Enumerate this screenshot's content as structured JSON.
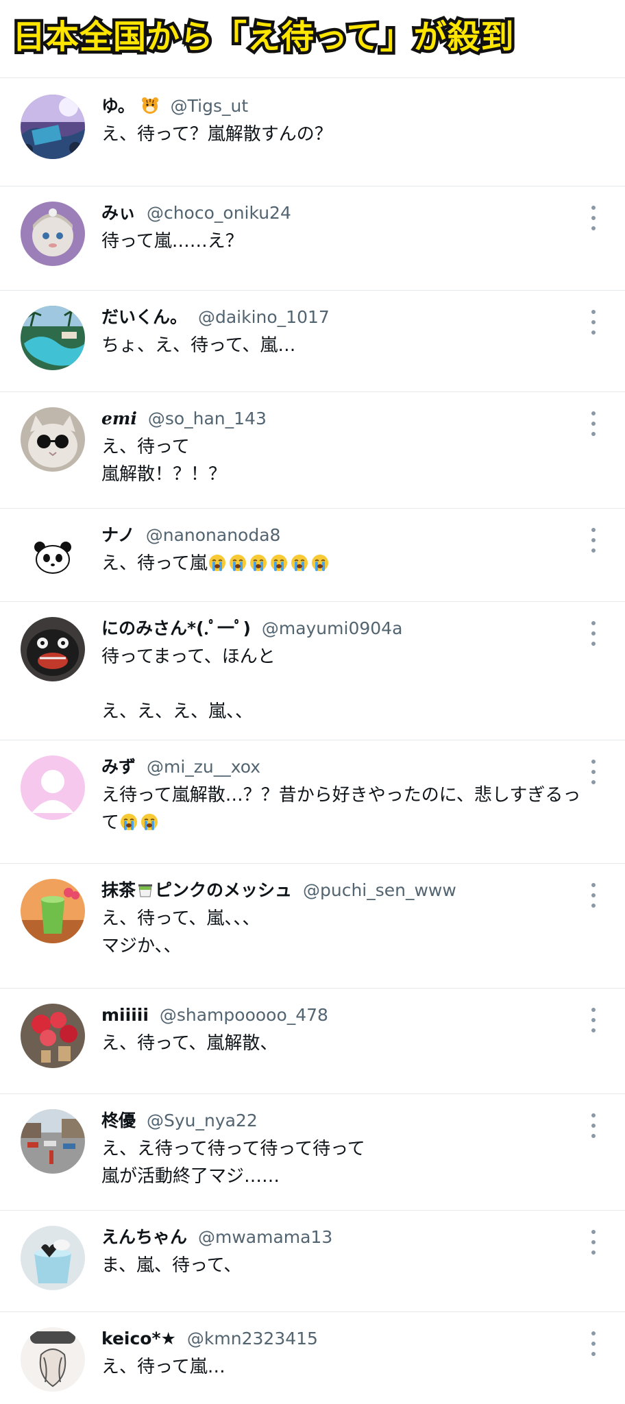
{
  "headline": "日本全国から「え待って」が殺到",
  "colors": {
    "headline_fill": "#ffe600",
    "headline_outline": "#111111",
    "handle": "#536471",
    "divider": "#e6e9ec"
  },
  "tweets": [
    {
      "name": "ゆ。",
      "name_emoji": "tiger-face-emoji",
      "handle": "@Tigs_ut",
      "text": "え、待って？嵐解散すんの？",
      "text_emoji_count": 0,
      "avatar_icon": "concert-crowd-avatar",
      "has_menu": false
    },
    {
      "name": "みぃ",
      "handle": "@choco_oniku24",
      "text": "待って嵐……え？",
      "text_emoji_count": 0,
      "avatar_icon": "plush-doll-avatar",
      "has_menu": true
    },
    {
      "name": "だいくん。",
      "handle": "@daikino_1017",
      "text": "ちょ、え、待って、嵐…",
      "text_emoji_count": 0,
      "avatar_icon": "resort-pool-avatar",
      "has_menu": true
    },
    {
      "name": "emi",
      "handle": "@so_han_143",
      "text": "え、待って\n嵐解散！？！？",
      "text_emoji_count": 0,
      "avatar_icon": "cat-sunglasses-avatar",
      "has_menu": true
    },
    {
      "name": "ナノ",
      "handle": "@nanonanoda8",
      "text": "え、待って嵐",
      "text_emoji_count": 6,
      "text_emoji": "loudly-crying-face-emoji",
      "avatar_icon": "panda-avatar",
      "has_menu": true
    },
    {
      "name": "にのみさん*(.ﾟ一ﾟ)",
      "handle": "@mayumi0904a",
      "text": "待ってまって、ほんと\n\nえ、え、え、嵐、、",
      "text_emoji_count": 0,
      "avatar_icon": "black-creature-avatar",
      "has_menu": true
    },
    {
      "name": "みず",
      "handle": "@mi_zu__xox",
      "text": "え待って嵐解散…？？昔から好きやったのに、悲しすぎるって",
      "text_emoji_count": 2,
      "text_emoji": "loudly-crying-face-emoji",
      "avatar_icon": "default-user-avatar",
      "has_menu": true
    },
    {
      "name": "抹茶",
      "name_emoji": "matcha-cup-emoji",
      "name_suffix": "ピンクのメッシュ",
      "handle": "@puchi_sen_www",
      "text": "え、待って、嵐、、、\nマジか、、",
      "text_emoji_count": 0,
      "avatar_icon": "green-drink-avatar",
      "has_menu": true
    },
    {
      "name": "miiiii",
      "handle": "@shampooooo_478",
      "text": "え、待って、嵐解散、",
      "text_emoji_count": 0,
      "avatar_icon": "red-flowers-avatar",
      "has_menu": true
    },
    {
      "name": "柊優",
      "handle": "@Syu_nya22",
      "text": "え、え待って待って待って待って\n嵐が活動終了マジ……",
      "text_emoji_count": 0,
      "avatar_icon": "street-photo-avatar",
      "has_menu": true
    },
    {
      "name": "えんちゃん",
      "handle": "@mwamama13",
      "text": "ま、嵐、待って、",
      "text_emoji_count": 0,
      "avatar_icon": "jelly-cup-avatar",
      "has_menu": true
    },
    {
      "name": "keico*★",
      "handle": "@kmn2323415",
      "text": "え、待って嵐…",
      "text_emoji_count": 0,
      "avatar_icon": "anime-art-avatar",
      "has_menu": true
    }
  ]
}
